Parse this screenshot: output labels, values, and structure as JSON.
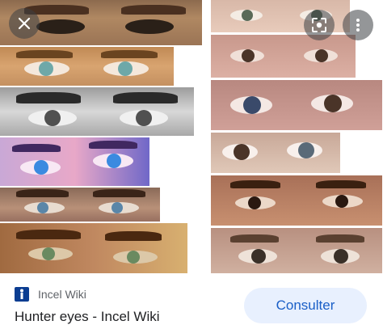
{
  "viewer": {
    "close_icon": "close-icon",
    "lens_icon": "google-lens-icon",
    "more_icon": "more-vertical-icon"
  },
  "result": {
    "source_name": "Incel Wiki",
    "title": "Hunter eyes - Incel Wiki",
    "visit_label": "Consulter"
  },
  "colors": {
    "visit_button_bg": "#e8f0fe",
    "visit_button_text": "#1a5fc7",
    "overlay_button_bg": "#3c4043"
  }
}
